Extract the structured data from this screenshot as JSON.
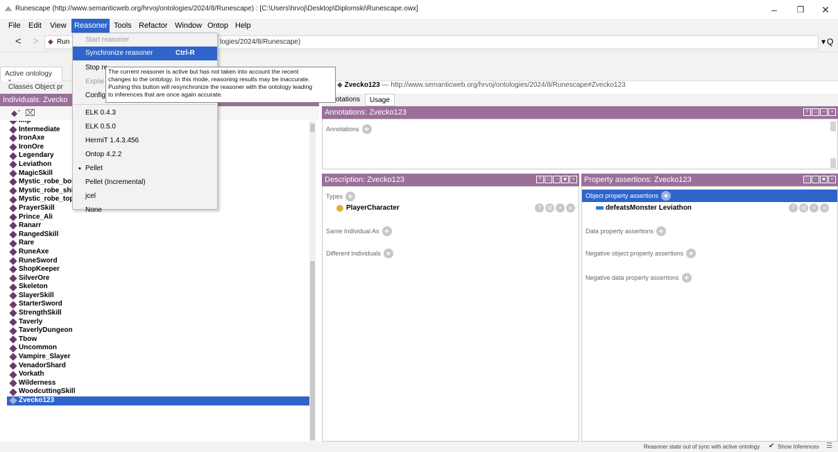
{
  "window": {
    "title": "Runescape (http://www.semanticweb.org/hrvoj/ontologies/2024/8/Runescape) : [C:\\Users\\hrvoj\\Desktop\\Diplomski\\Runescape.owx]",
    "controls": [
      "–",
      "❐",
      "✕"
    ]
  },
  "menubar": [
    "File",
    "Edit",
    "View",
    "Reasoner",
    "Tools",
    "Refactor",
    "Window",
    "Ontop",
    "Help"
  ],
  "nav": {
    "back": "<",
    "forward": ">",
    "ontology_short": "Run",
    "address_tail": "logies/2024/8/Runescape)",
    "dropdown": "▾",
    "search": "Q"
  },
  "tabs": {
    "active_ontology": "Active ontology",
    "close": "×",
    "subtabs_left": "Classes  Object pr",
    "individuals_header": "Individuals: Zvecko"
  },
  "reasoner_menu": {
    "items": [
      {
        "label": "Start reasoner",
        "state": "disabled"
      },
      {
        "label": "Synchronize reasoner",
        "shortcut": "Ctrl-R",
        "state": "highlighted"
      },
      {
        "label": "Stop re",
        "state": "normal"
      },
      {
        "label": "Explai",
        "state": "disabled"
      },
      {
        "label": "Configu",
        "state": "normal"
      },
      {
        "label": "ELK 0.4.3",
        "state": "normal"
      },
      {
        "label": "ELK 0.5.0",
        "state": "normal"
      },
      {
        "label": "HermiT 1.4.3.456",
        "state": "normal"
      },
      {
        "label": "Ontop 4.2.2",
        "state": "normal"
      },
      {
        "label": "Pellet",
        "state": "selected"
      },
      {
        "label": "Pellet (Incremental)",
        "state": "normal"
      },
      {
        "label": "jcel",
        "state": "normal"
      },
      {
        "label": "None",
        "state": "normal"
      }
    ]
  },
  "tooltip": [
    "The current reasoner is active but has not taken into account the recent",
    "changes to the ontology. In this mode, reasoning results may be inaccurate.",
    "Pushing this button will resynchronize the reasoner with the ontology leading",
    "to inferences that are once again accurate."
  ],
  "individuals": [
    "Imp",
    "Intermediate",
    "IronAxe",
    "IronOre",
    "Legendary",
    "Leviathon",
    "MagicSkill",
    "Mystic_robe_bot",
    "Mystic_robe_shi",
    "Mystic_robe_top",
    "PrayerSkill",
    "Prince_Ali",
    "Ranarr",
    "RangedSkill",
    "Rare",
    "RuneAxe",
    "RuneSword",
    "ShopKeeper",
    "SilverOre",
    "Skeleton",
    "SlayerSkill",
    "StarterSword",
    "StrengthSkill",
    "Taverly",
    "TaverlyDungeon",
    "Tbow",
    "Uncommon",
    "Vampire_Slayer",
    "VenadorShard",
    "Vorkath",
    "Wilderness",
    "WoodcuttingSkill",
    "Zvecko123"
  ],
  "selected_individual": "Zvecko123",
  "entity": {
    "name": "Zvecko123",
    "iri": "— http://www.semanticweb.org/hrvoj/ontologies/2024/8/Runescape#Zvecko123",
    "tab_annotations": "otations",
    "tab_usage": "Usage"
  },
  "annotations_panel": {
    "header": "Annotations: Zvecko123",
    "label": "Annotations"
  },
  "description_panel": {
    "header": "Description: Zvecko123",
    "types_label": "Types",
    "type_value": "PlayerCharacter",
    "same_label": "Same Individual As",
    "different_label": "Different Individuals"
  },
  "property_panel": {
    "header": "Property assertions: Zvecko123",
    "object_label": "Object property assertions",
    "object_assertion_prop": "defeatsMonster",
    "object_assertion_value": "Leviathon",
    "data_label": "Data property assertions",
    "neg_object_label": "Negative object property assertions",
    "neg_data_label": "Negative data property assertions"
  },
  "row_buttons": [
    "?",
    "@",
    "×",
    "o"
  ],
  "status": {
    "message": "Reasoner state out of sync with active ontology",
    "show_inferences": "Show Inferences",
    "checked": true
  },
  "colors": {
    "header_purple": "#9b6f9a",
    "selection_blue": "#2f65ca",
    "type_dot": "#e0b23a",
    "property_blue": "#2f7fd6"
  }
}
